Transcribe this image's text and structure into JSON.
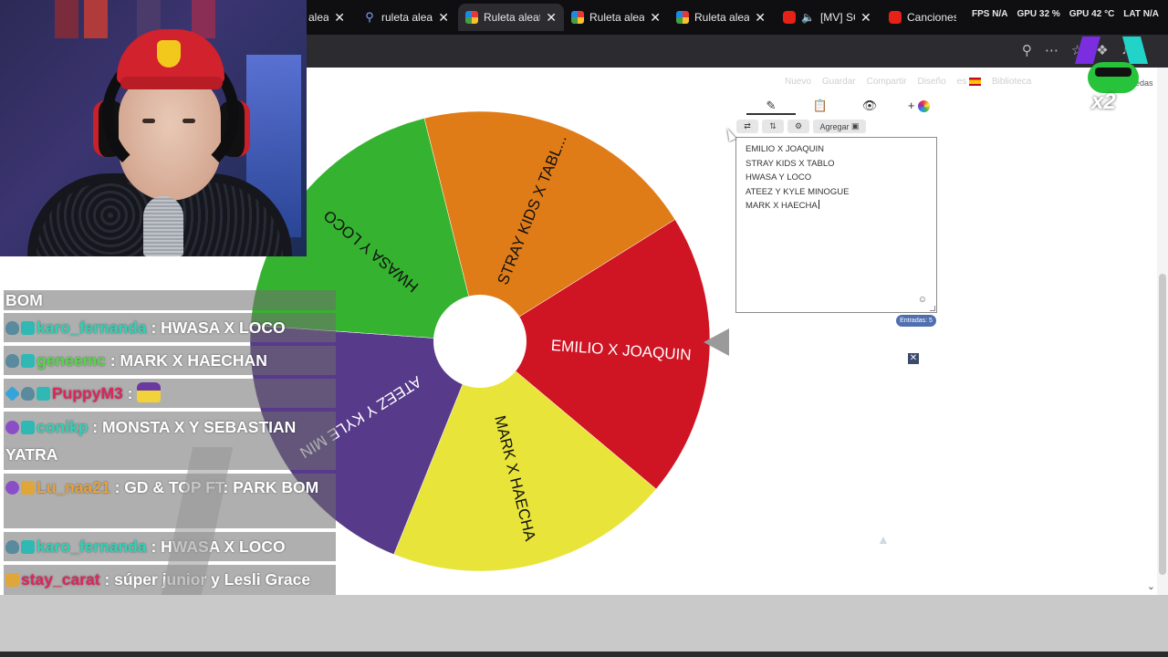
{
  "browser": {
    "tabs": [
      {
        "label": "aleat",
        "favicon": "wheel",
        "active": false
      },
      {
        "label": "ruleta aleatoria",
        "favicon": "search-icon",
        "active": false
      },
      {
        "label": "Ruleta aleatoria",
        "favicon": "wheel",
        "active": true
      },
      {
        "label": "Ruleta aleatoria",
        "favicon": "wheel",
        "active": false
      },
      {
        "label": "Ruleta aleatoria",
        "favicon": "wheel",
        "active": false
      },
      {
        "label": "[MV] SO",
        "favicon": "youtube",
        "active": false
      },
      {
        "label": "Canciones d",
        "favicon": "youtube",
        "active": false
      }
    ],
    "close_glyph": "✕",
    "sysinfo": [
      "FPS N/A",
      "GPU 32 %",
      "GPU 42 °C",
      "LAT N/A"
    ]
  },
  "site_menu": {
    "items": [
      "Nuevo",
      "Guardar",
      "Compartir",
      "Diseño",
      "es",
      "Biblioteca",
      "ruedas"
    ]
  },
  "wheel": {
    "segments": [
      {
        "label": "EMILIO X JOAQUIN",
        "color": "#cf1424"
      },
      {
        "label": "MARK X HAECHA",
        "color": "#e8e43a"
      },
      {
        "label": "ATEEZ Y KYLE MIN",
        "color": "#573a8a"
      },
      {
        "label": "HWASA Y LOCO",
        "color": "#35b22f"
      },
      {
        "label": "STRAY KIDS X TABL...",
        "color": "#e07c17"
      }
    ]
  },
  "editor": {
    "toolbar_icons": [
      "pencil-icon",
      "clipboard-icon",
      "eye-off-icon",
      "palette-icon"
    ],
    "add_label": "Agregar",
    "entries": [
      "EMILIO X JOAQUIN",
      "STRAY KIDS X TABLO",
      "HWASA Y LOCO",
      "ATEEZ Y KYLE MINOGUE",
      "MARK X HAECHA"
    ],
    "entries_count_label": "Entradas: 5"
  },
  "chat": {
    "messages": [
      {
        "user": "",
        "user_color": "#ffffff",
        "badges": [],
        "text": "BOM"
      },
      {
        "user": "karo_fernanda",
        "user_color": "#2ed3b7",
        "badges": [
          "mod",
          "gc"
        ],
        "text": ": HWASA X LOCO"
      },
      {
        "user": "geneemc",
        "user_color": "#56d64a",
        "badges": [
          "mod",
          "gc"
        ],
        "text": ": MARK X HAECHAN"
      },
      {
        "user": "PuppyM3",
        "user_color": "#e0245e",
        "badges": [
          "prime",
          "mod",
          "gc"
        ],
        "text": ":"
      },
      {
        "user": "conikp",
        "user_color": "#2ed3b7",
        "badges": [
          "sub",
          "gc"
        ],
        "text": ": MONSTA X Y SEBASTIAN YATRA"
      },
      {
        "user": "Lu_naa21",
        "user_color": "#e7a23a",
        "badges": [
          "sub",
          "crown"
        ],
        "text": ": GD & TOP FT: PARK BOM"
      },
      {
        "user": "karo_fernanda",
        "user_color": "#2ed3b7",
        "badges": [
          "mod",
          "gc"
        ],
        "text": ": HWASA X LOCO"
      },
      {
        "user": "stay_carat",
        "user_color": "#e0245e",
        "badges": [
          "crown"
        ],
        "text": ": súper junior y Lesli Grace"
      }
    ]
  },
  "overlay": {
    "multiplier": "x2"
  }
}
